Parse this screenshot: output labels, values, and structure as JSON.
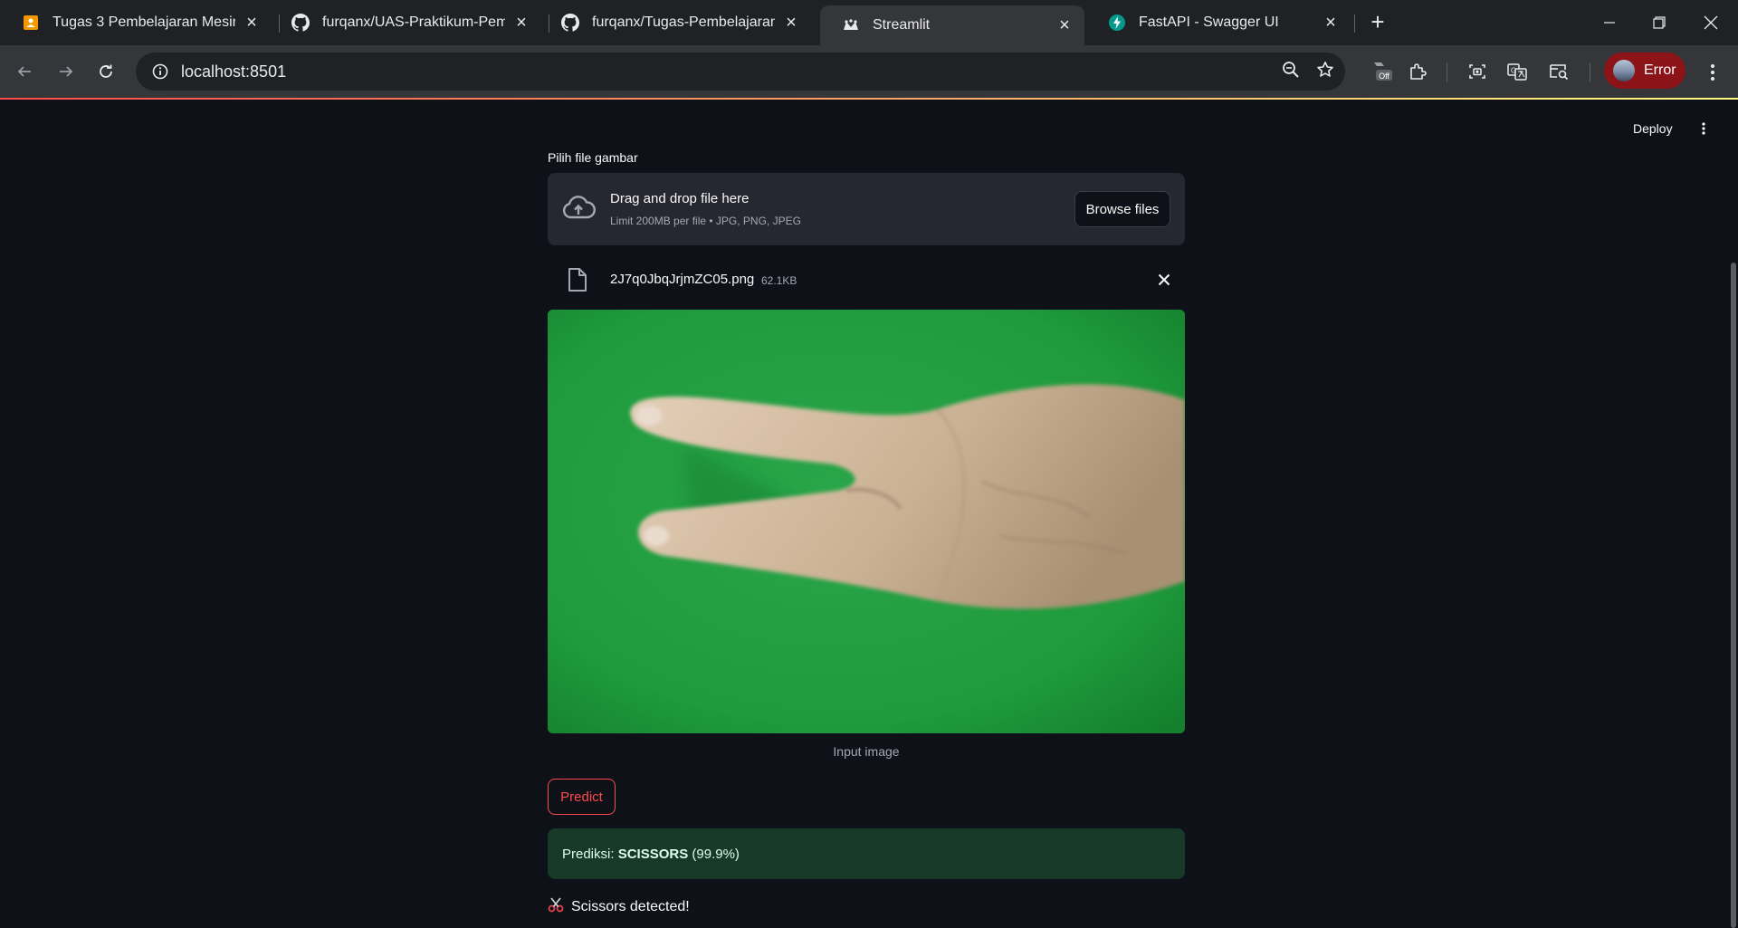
{
  "browser": {
    "tabs": [
      {
        "title": "Tugas 3 Pembelajaran Mesin",
        "icon": "slides-icon",
        "active": false
      },
      {
        "title": "furqanx/UAS-Praktikum-Pembe",
        "icon": "github-icon",
        "active": false
      },
      {
        "title": "furqanx/Tugas-Pembelajaran-M",
        "icon": "github-icon",
        "active": false
      },
      {
        "title": "Streamlit",
        "icon": "streamlit-icon",
        "active": true
      },
      {
        "title": "FastAPI - Swagger UI",
        "icon": "fastapi-icon",
        "active": false
      }
    ],
    "address": "localhost:8501",
    "extension_badge": "Off",
    "profile_label": "Error"
  },
  "app": {
    "deploy_label": "Deploy",
    "uploader": {
      "label": "Pilih file gambar",
      "drop_title": "Drag and drop file here",
      "drop_subtitle": "Limit 200MB per file • JPG, PNG, JPEG",
      "browse_label": "Browse files"
    },
    "file": {
      "name": "2J7q0JbqJrjmZC05.png",
      "size": "62.1KB"
    },
    "image_caption": "Input image",
    "predict_label": "Predict",
    "prediction": {
      "prefix": "Prediksi: ",
      "label": "SCISSORS",
      "confidence": " (99.9%)"
    },
    "result_text": "Scissors detected!",
    "colors": {
      "accent": "#ff4b4b",
      "background": "#0e1117",
      "success_bg": "#173928",
      "green_screen": "#1e9a3a"
    }
  }
}
